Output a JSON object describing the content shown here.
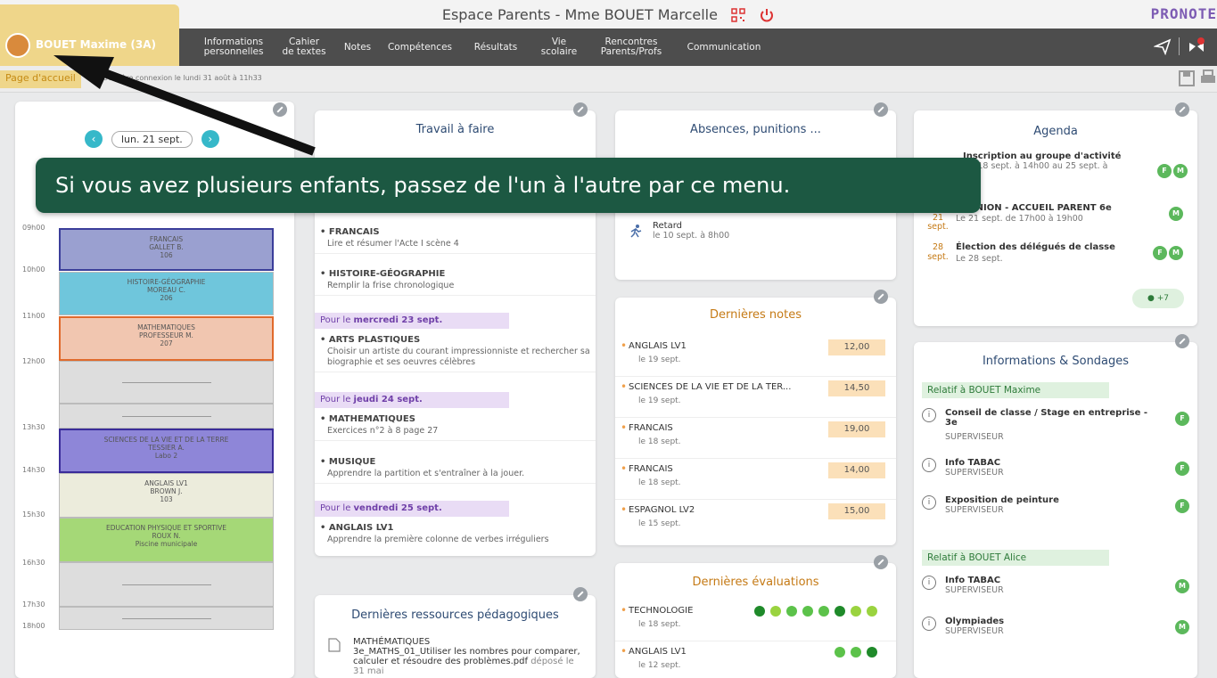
{
  "window": {
    "title": "Espace Parents - Mme BOUET Marcelle",
    "brand": "PRONOTE"
  },
  "child_selector": {
    "name": "BOUET Maxime (3A)"
  },
  "nav": [
    {
      "label": "Informations personnelles",
      "l1": "Informations",
      "l2": "personnelles"
    },
    {
      "label": "Cahier de textes",
      "l1": "Cahier",
      "l2": "de textes"
    },
    {
      "label": "Notes",
      "l1": "Notes",
      "l2": ""
    },
    {
      "label": "Compétences",
      "l1": "Compétences",
      "l2": ""
    },
    {
      "label": "Résultats",
      "l1": "Résultats",
      "l2": ""
    },
    {
      "label": "Vie scolaire",
      "l1": "Vie",
      "l2": "scolaire"
    },
    {
      "label": "Rencontres Parents/Profs",
      "l1": "Rencontres",
      "l2": "Parents/Profs"
    },
    {
      "label": "Communication",
      "l1": "Communication",
      "l2": ""
    }
  ],
  "breadcrumb": {
    "page": "Page d'accueil",
    "last_connection": "Dernière connexion le lundi 31 août à 11h33"
  },
  "timetable": {
    "date": "lun. 21 sept.",
    "hours": [
      "09h00",
      "10h00",
      "11h00",
      "12h00",
      "13h30",
      "14h30",
      "15h30",
      "16h30",
      "17h30",
      "18h00"
    ],
    "courses": [
      {
        "subject": "FRANCAIS",
        "teacher": "GALLET B.",
        "room": "106"
      },
      {
        "subject": "HISTOIRE-GÉOGRAPHIE",
        "teacher": "MOREAU C.",
        "room": "206"
      },
      {
        "subject": "MATHEMATIQUES",
        "teacher": "PROFESSEUR M.",
        "room": "207"
      },
      {
        "subject": "SCIENCES DE LA VIE ET DE LA TERRE",
        "teacher": "TESSIER A.",
        "room": "Labo 2"
      },
      {
        "subject": "ANGLAIS LV1",
        "teacher": "BROWN J.",
        "room": "103"
      },
      {
        "subject": "EDUCATION PHYSIQUE ET SPORTIVE",
        "teacher": "ROUX N.",
        "room": "Piscine municipale"
      }
    ]
  },
  "homework": {
    "title": "Travail à faire",
    "days": [
      {
        "prefix": "Pour le ",
        "day": "mercredi 23 sept."
      },
      {
        "prefix": "Pour le ",
        "day": "jeudi 24 sept."
      },
      {
        "prefix": "Pour le ",
        "day": "vendredi 25 sept."
      }
    ],
    "items": [
      {
        "subject": "FRANCAIS",
        "desc": "Lire et résumer l'Acte I scène 4"
      },
      {
        "subject": "HISTOIRE-GÉOGRAPHIE",
        "desc": "Remplir la frise chronologique"
      },
      {
        "subject": "ARTS PLASTIQUES",
        "desc": "Choisir un artiste du courant impressionniste et rechercher sa biographie et ses oeuvres célèbres"
      },
      {
        "subject": "MATHEMATIQUES",
        "desc": "Exercices n°2 à 8 page 27"
      },
      {
        "subject": "MUSIQUE",
        "desc": "Apprendre la partition et s'entraîner à la jouer."
      },
      {
        "subject": "ANGLAIS LV1",
        "desc": "Apprendre la première colonne de verbes irréguliers"
      }
    ]
  },
  "resources": {
    "title": "Dernières ressources pédagogiques",
    "subject": "MATHÉMATIQUES",
    "file": "3e_MATHS_01_Utiliser les nombres pour comparer, calculer et résoudre des problèmes.pdf",
    "deposit": "déposé le 31 mai"
  },
  "absences": {
    "title": "Absences, punitions ...",
    "item_label": "Retard",
    "item_date": "le 10 sept. à 8h00"
  },
  "grades": {
    "title": "Dernières notes",
    "items": [
      {
        "subject": "ANGLAIS LV1",
        "date": "le 19 sept.",
        "value": "12,00"
      },
      {
        "subject": "SCIENCES DE LA VIE ET DE LA TER...",
        "date": "le 19 sept.",
        "value": "14,50"
      },
      {
        "subject": "FRANCAIS",
        "date": "le 18 sept.",
        "value": "19,00"
      },
      {
        "subject": "FRANCAIS",
        "date": "le 18 sept.",
        "value": "14,00"
      },
      {
        "subject": "ESPAGNOL LV2",
        "date": "le 15 sept.",
        "value": "15,00"
      }
    ]
  },
  "evaluations": {
    "title": "Dernières évaluations",
    "items": [
      {
        "subject": "TECHNOLOGIE",
        "date": "le 18 sept.",
        "dots": 8
      },
      {
        "subject": "ANGLAIS LV1",
        "date": "le 12 sept.",
        "dots": 3
      }
    ]
  },
  "agenda": {
    "title": "Agenda",
    "items": [
      {
        "title": "Inscription au groupe d'activité",
        "detail": "Du 18 sept. à 14h00 au 25 sept. à"
      },
      {
        "day": "21",
        "month": "sept.",
        "title": "RÉUNION - ACCUEIL PARENT 6e",
        "detail": "Le 21 sept. de 17h00 à 19h00"
      },
      {
        "day": "28",
        "month": "sept.",
        "title": "Élection des délégués de classe",
        "detail": "Le 28 sept."
      }
    ],
    "more": "+7"
  },
  "info": {
    "title": "Informations & Sondages",
    "group1": "Relatif à BOUET Maxime",
    "group2": "Relatif à BOUET Alice",
    "items1": [
      {
        "title": "Conseil de classe / Stage en entreprise - 3e",
        "author": "SUPERVISEUR",
        "badge": "F"
      },
      {
        "title": "Info TABAC",
        "author": "SUPERVISEUR",
        "badge": "F"
      },
      {
        "title": "Exposition de peinture",
        "author": "SUPERVISEUR",
        "badge": "F"
      }
    ],
    "items2": [
      {
        "title": "Info TABAC",
        "author": "SUPERVISEUR",
        "badge": "M"
      },
      {
        "title": "Olympiades",
        "author": "SUPERVISEUR",
        "badge": "M"
      }
    ]
  },
  "tip": {
    "text": "Si vous avez plusieurs enfants, passez de l'un à l'autre par ce menu."
  },
  "colors": {
    "tip_bg": "#1c5842",
    "accent": "#36b8c9",
    "badge": "#5cb85c"
  }
}
